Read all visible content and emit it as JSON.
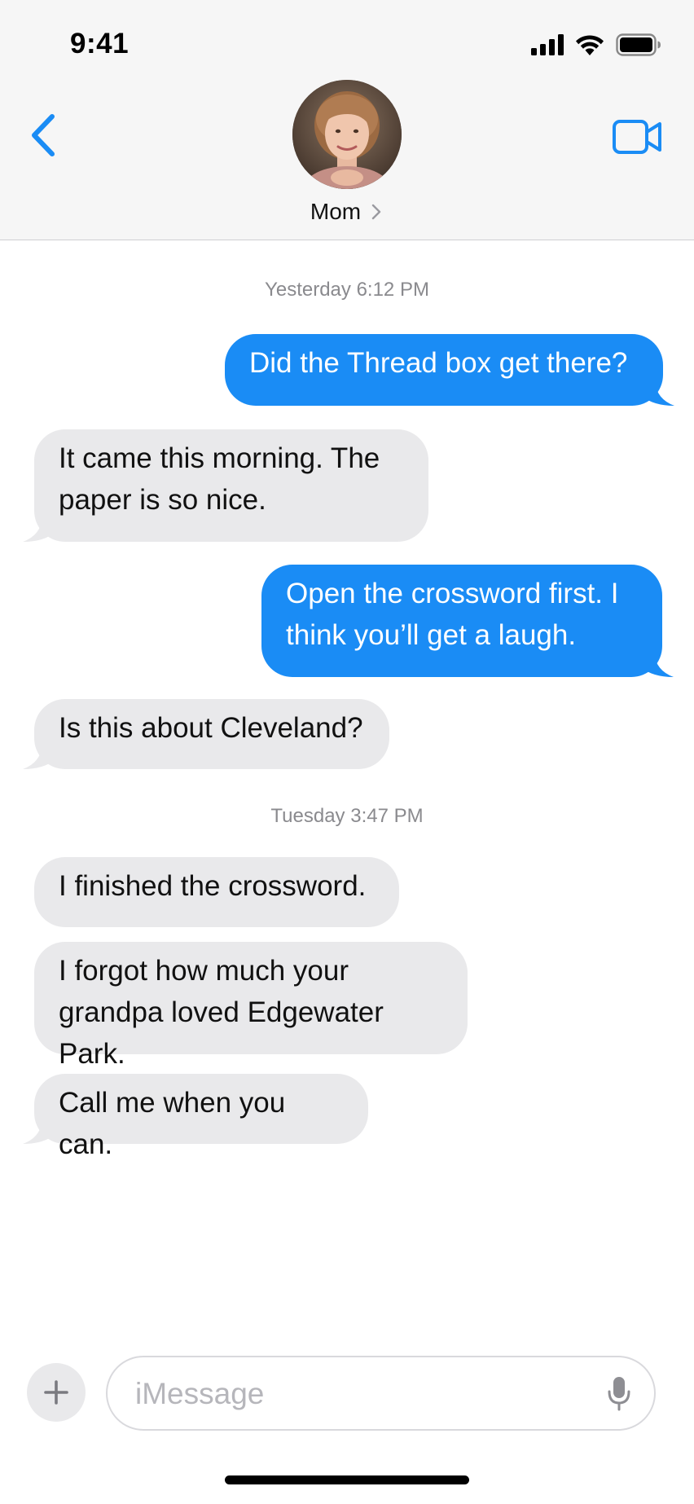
{
  "status_bar": {
    "time": "9:41"
  },
  "header": {
    "contact_name": "Mom",
    "icons": {
      "back": "chevron-left-icon",
      "video": "video-camera-icon",
      "disclosure": "chevron-right-icon"
    }
  },
  "colors": {
    "accent": "#1a8cf5",
    "incoming_bubble": "#e9e9eb",
    "timestamp": "#8a8a8e",
    "header_bg": "#f6f6f6"
  },
  "conversation": {
    "timestamp_1": "Yesterday 6:12 PM",
    "messages_group_1": [
      {
        "direction": "outgoing",
        "text": "Did the Thread box get there?"
      },
      {
        "direction": "incoming",
        "text": "It came this morning. The\npaper is so nice."
      },
      {
        "direction": "outgoing",
        "text": "Open the crossword first. I\nthink you’ll get a laugh."
      },
      {
        "direction": "incoming",
        "text": "Is this about Cleveland?"
      }
    ],
    "timestamp_2": "Tuesday 3:47 PM",
    "messages_group_2": [
      {
        "direction": "incoming",
        "text": "I finished the crossword."
      },
      {
        "direction": "incoming",
        "text": "I forgot how much your\ngrandpa loved Edgewater Park."
      },
      {
        "direction": "incoming",
        "text": "Call me when you can."
      }
    ]
  },
  "composer": {
    "placeholder": "iMessage",
    "value": "",
    "icons": {
      "add": "plus-icon",
      "mic": "microphone-icon"
    }
  }
}
